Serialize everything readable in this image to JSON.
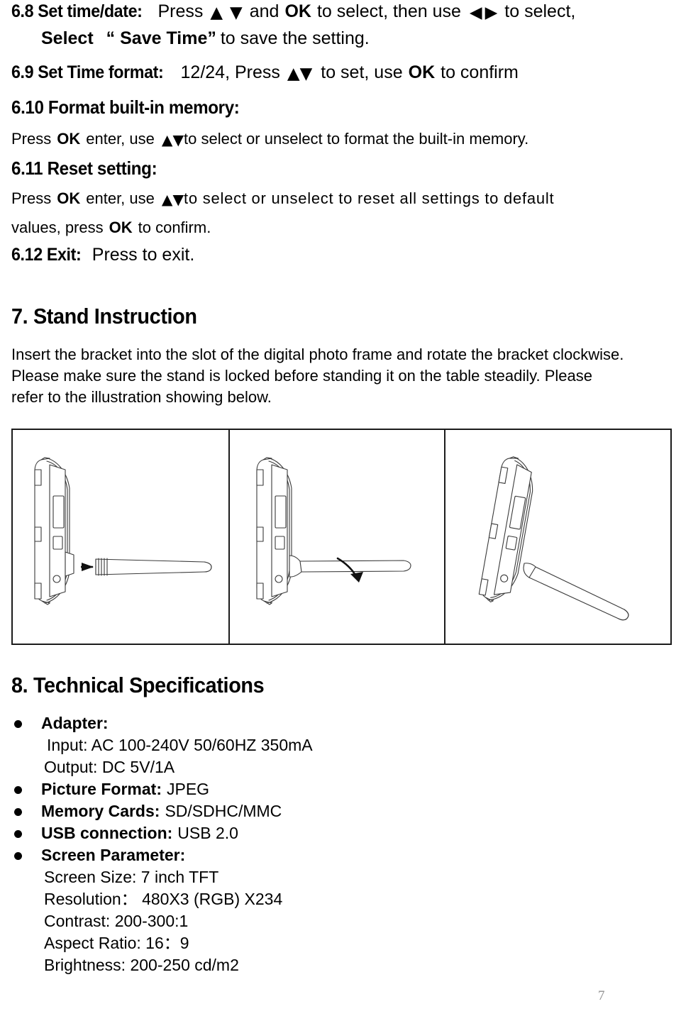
{
  "document": {
    "page_number": "7"
  },
  "section6": {
    "item_68": {
      "heading": "6.8 Set time/date:",
      "line1_part1": "Press",
      "arrow_up": "▲",
      "arrow_down": "▼",
      "line1_part2": "and",
      "key_ok": "OK",
      "line1_part3": "to select, then use",
      "arrow_left": "◀",
      "arrow_right": "▶",
      "line1_part4": "to select,",
      "line2_select": "Select",
      "line2_quoted": "“ Save Time”",
      "line2_tail": "to save the setting."
    },
    "item_69": {
      "heading": "6.9 Set Time format:",
      "part1": "12/24, Press",
      "arrows": "▲▼",
      "part2": "to set, use",
      "key_ok": "OK",
      "part3": "to confirm"
    },
    "item_610": {
      "heading": "6.10 Format built-in memory:",
      "part1": "Press",
      "key_ok": "OK",
      "part2": "enter, use",
      "arrows": "▲▼",
      "part3": "to select or unselect to format the built-in memory."
    },
    "item_611": {
      "heading": "6.11 Reset setting:",
      "part1": "Press",
      "key_ok": "OK",
      "part2": "enter, use",
      "arrows": "▲▼",
      "part3": "to select or unselect to reset all settings to default",
      "line2_part1": "values, press",
      "line2_key_ok": "OK",
      "line2_part2": "to confirm."
    },
    "item_612": {
      "heading": "6.12 Exit:",
      "text": "Press to exit."
    }
  },
  "section7": {
    "heading": "7. Stand Instruction",
    "paragraph": "Insert the bracket into the slot of the digital photo frame and rotate the bracket clockwise. Please make sure the stand is locked before standing it on the table steadily. Please refer to the illustration showing below.",
    "figures": [
      {
        "name": "insert-bracket",
        "caption": ""
      },
      {
        "name": "rotate-bracket",
        "caption": ""
      },
      {
        "name": "frame-standing",
        "caption": ""
      }
    ]
  },
  "section8": {
    "heading": "8. Technical Specifications",
    "items": [
      {
        "label": "Adapter:",
        "value": "",
        "sublines": [
          "Input: AC 100-240V    50/60HZ    350mA",
          "Output: DC 5V/1A"
        ]
      },
      {
        "label": "Picture Format:",
        "value": "JPEG",
        "sublines": []
      },
      {
        "label": "Memory Cards:",
        "value": "SD/SDHC/MMC",
        "sublines": []
      },
      {
        "label": "USB connection:",
        "value": "USB 2.0",
        "sublines": []
      },
      {
        "label": "Screen Parameter:",
        "value": "",
        "sublines": [
          "Screen Size: 7 inch TFT",
          "Resolution：   480X3 (RGB) X234",
          "Contrast: 200-300:1",
          "Aspect Ratio: 16：9",
          "Brightness: 200-250 cd/m2"
        ]
      }
    ]
  }
}
